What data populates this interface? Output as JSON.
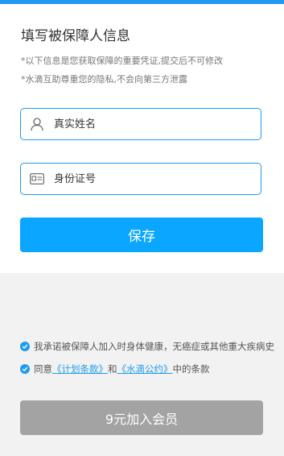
{
  "header": {
    "title": "填写被保障人信息",
    "note1": "*以下信息是您获取保障的重要凭证,提交后不可修改",
    "note2": "*水滴互助尊重您的隐私,不会向第三方泄露"
  },
  "form": {
    "name_placeholder": "真实姓名",
    "name_icon": "person-icon",
    "id_placeholder": "身份证号",
    "id_icon": "id-card-icon",
    "save_label": "保存"
  },
  "agreements": {
    "promise_text": "我承诺被保障人加入时身体健康，无癌症或其他重大疾病史",
    "agree_prefix": "同意",
    "plan_terms_link": "《计划条款》",
    "and_text": "和",
    "pact_link": "《水滴公约》",
    "agree_suffix": "中的条款"
  },
  "footer": {
    "join_label": "9元加入会员"
  },
  "colors": {
    "accent": "#1e9bf0",
    "save_button": "#0aa6ff",
    "disabled_button": "#a3a3a3",
    "background": "#f2f2f2"
  }
}
